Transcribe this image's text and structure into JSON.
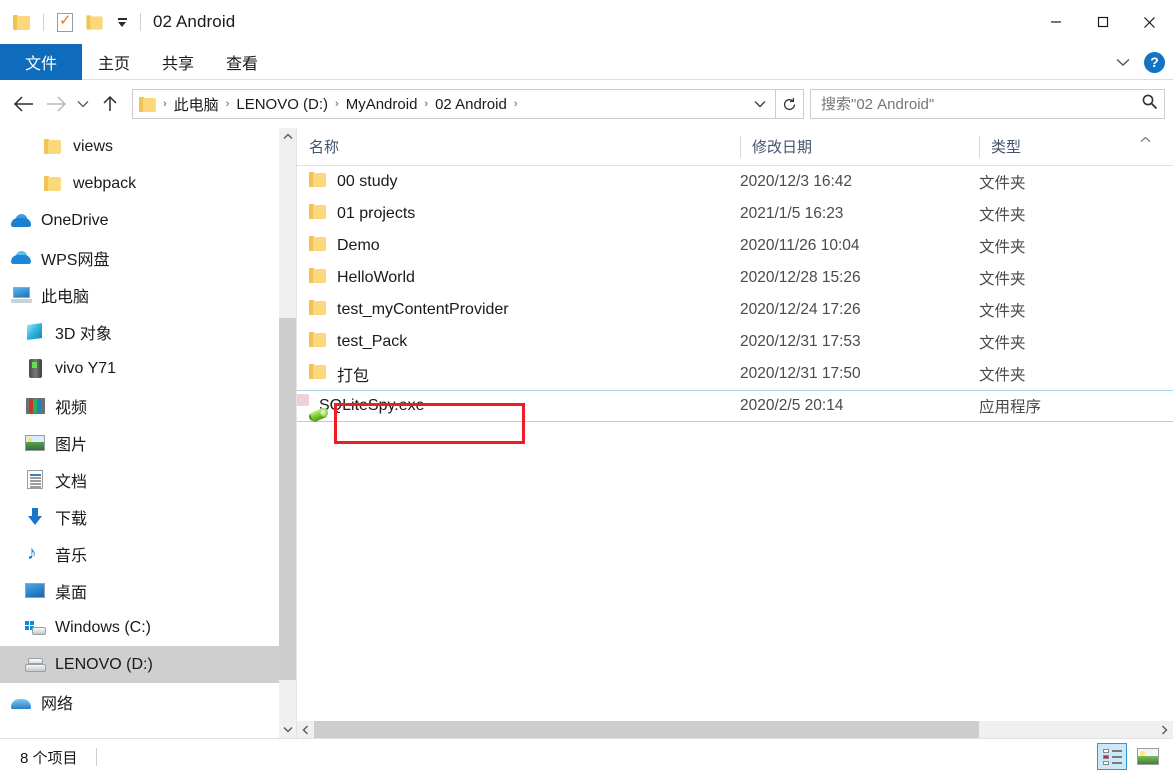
{
  "window": {
    "title": "02 Android",
    "minimize_label": "最小化",
    "maximize_label": "最大化",
    "close_label": "关闭"
  },
  "quick_access": {
    "app_icon": "folder-icon",
    "properties_icon": "properties-icon",
    "new_folder_icon": "new-folder-icon",
    "customize_icon": "customize-quick-access-icon"
  },
  "ribbon": {
    "tabs": [
      {
        "label": "文件",
        "active": true
      },
      {
        "label": "主页",
        "active": false
      },
      {
        "label": "共享",
        "active": false
      },
      {
        "label": "查看",
        "active": false
      }
    ],
    "expand_icon": "chevron-down-icon",
    "help_label": "?"
  },
  "address_bar": {
    "back_icon": "back-arrow-icon",
    "forward_icon": "forward-arrow-icon",
    "recent_icon": "recent-locations-icon",
    "up_icon": "up-arrow-icon",
    "breadcrumb": [
      "此电脑",
      "LENOVO (D:)",
      "MyAndroid",
      "02 Android"
    ],
    "separator": "›",
    "dropdown_icon": "chevron-down-icon",
    "refresh_icon": "refresh-icon"
  },
  "search": {
    "placeholder": "搜索\"02 Android\"",
    "value": "",
    "icon": "search-icon"
  },
  "sidebar": {
    "items": [
      {
        "label": "views",
        "icon": "folder-icon",
        "indent": 1,
        "selected": false
      },
      {
        "label": "webpack",
        "icon": "folder-icon",
        "indent": 1,
        "selected": false
      },
      {
        "label": "OneDrive",
        "icon": "onedrive-icon",
        "indent": 0,
        "selected": false
      },
      {
        "label": "WPS网盘",
        "icon": "wps-cloud-icon",
        "indent": 0,
        "selected": false
      },
      {
        "label": "此电脑",
        "icon": "this-pc-icon",
        "indent": 0,
        "selected": false
      },
      {
        "label": "3D 对象",
        "icon": "3d-objects-icon",
        "indent": 2,
        "selected": false
      },
      {
        "label": "vivo Y71",
        "icon": "phone-icon",
        "indent": 2,
        "selected": false
      },
      {
        "label": "视频",
        "icon": "videos-icon",
        "indent": 2,
        "selected": false
      },
      {
        "label": "图片",
        "icon": "pictures-icon",
        "indent": 2,
        "selected": false
      },
      {
        "label": "文档",
        "icon": "documents-icon",
        "indent": 2,
        "selected": false
      },
      {
        "label": "下载",
        "icon": "downloads-icon",
        "indent": 2,
        "selected": false
      },
      {
        "label": "音乐",
        "icon": "music-icon",
        "indent": 2,
        "selected": false
      },
      {
        "label": "桌面",
        "icon": "desktop-icon",
        "indent": 2,
        "selected": false
      },
      {
        "label": "Windows (C:)",
        "icon": "windows-drive-icon",
        "indent": 2,
        "selected": false
      },
      {
        "label": "LENOVO (D:)",
        "icon": "drive-icon",
        "indent": 2,
        "selected": true
      },
      {
        "label": "网络",
        "icon": "network-icon",
        "indent": 0,
        "selected": false
      }
    ],
    "scroll_up_icon": "scroll-up-icon",
    "scroll_down_icon": "scroll-down-icon"
  },
  "file_list": {
    "columns": [
      {
        "key": "name",
        "label": "名称"
      },
      {
        "key": "date",
        "label": "修改日期"
      },
      {
        "key": "type",
        "label": "类型"
      }
    ],
    "sort_indicator": "^",
    "rows": [
      {
        "name": "00 study",
        "date": "2020/12/3 16:42",
        "type": "文件夹",
        "icon": "folder-icon",
        "highlighted": false
      },
      {
        "name": "01 projects",
        "date": "2021/1/5 16:23",
        "type": "文件夹",
        "icon": "folder-icon",
        "highlighted": false
      },
      {
        "name": "Demo",
        "date": "2020/11/26 10:04",
        "type": "文件夹",
        "icon": "folder-icon",
        "highlighted": false
      },
      {
        "name": "HelloWorld",
        "date": "2020/12/28 15:26",
        "type": "文件夹",
        "icon": "folder-icon",
        "highlighted": false
      },
      {
        "name": "test_myContentProvider",
        "date": "2020/12/24 17:26",
        "type": "文件夹",
        "icon": "folder-icon",
        "highlighted": false
      },
      {
        "name": "test_Pack",
        "date": "2020/12/31 17:53",
        "type": "文件夹",
        "icon": "folder-icon",
        "highlighted": false
      },
      {
        "name": "打包",
        "date": "2020/12/31 17:50",
        "type": "文件夹",
        "icon": "folder-icon",
        "highlighted": false
      },
      {
        "name": "SQLiteSpy.exe",
        "date": "2020/2/5 20:14",
        "type": "应用程序",
        "icon": "exe-icon",
        "highlighted": true
      }
    ],
    "annotation": {
      "target": "SQLiteSpy.exe",
      "color": "#ee1c25"
    },
    "h_scroll_left_icon": "scroll-left-icon",
    "h_scroll_right_icon": "scroll-right-icon"
  },
  "status_bar": {
    "item_count": "8 个项目",
    "views": [
      {
        "name": "details-view",
        "label": "详细信息",
        "active": true
      },
      {
        "name": "large-icons-view",
        "label": "大图标",
        "active": false
      }
    ]
  },
  "colors": {
    "accent": "#0f6cbd",
    "selection": "#cfcfcf",
    "hover_row": "#e5f3fd",
    "annotation": "#ee1c25",
    "header_text": "#44546f"
  }
}
